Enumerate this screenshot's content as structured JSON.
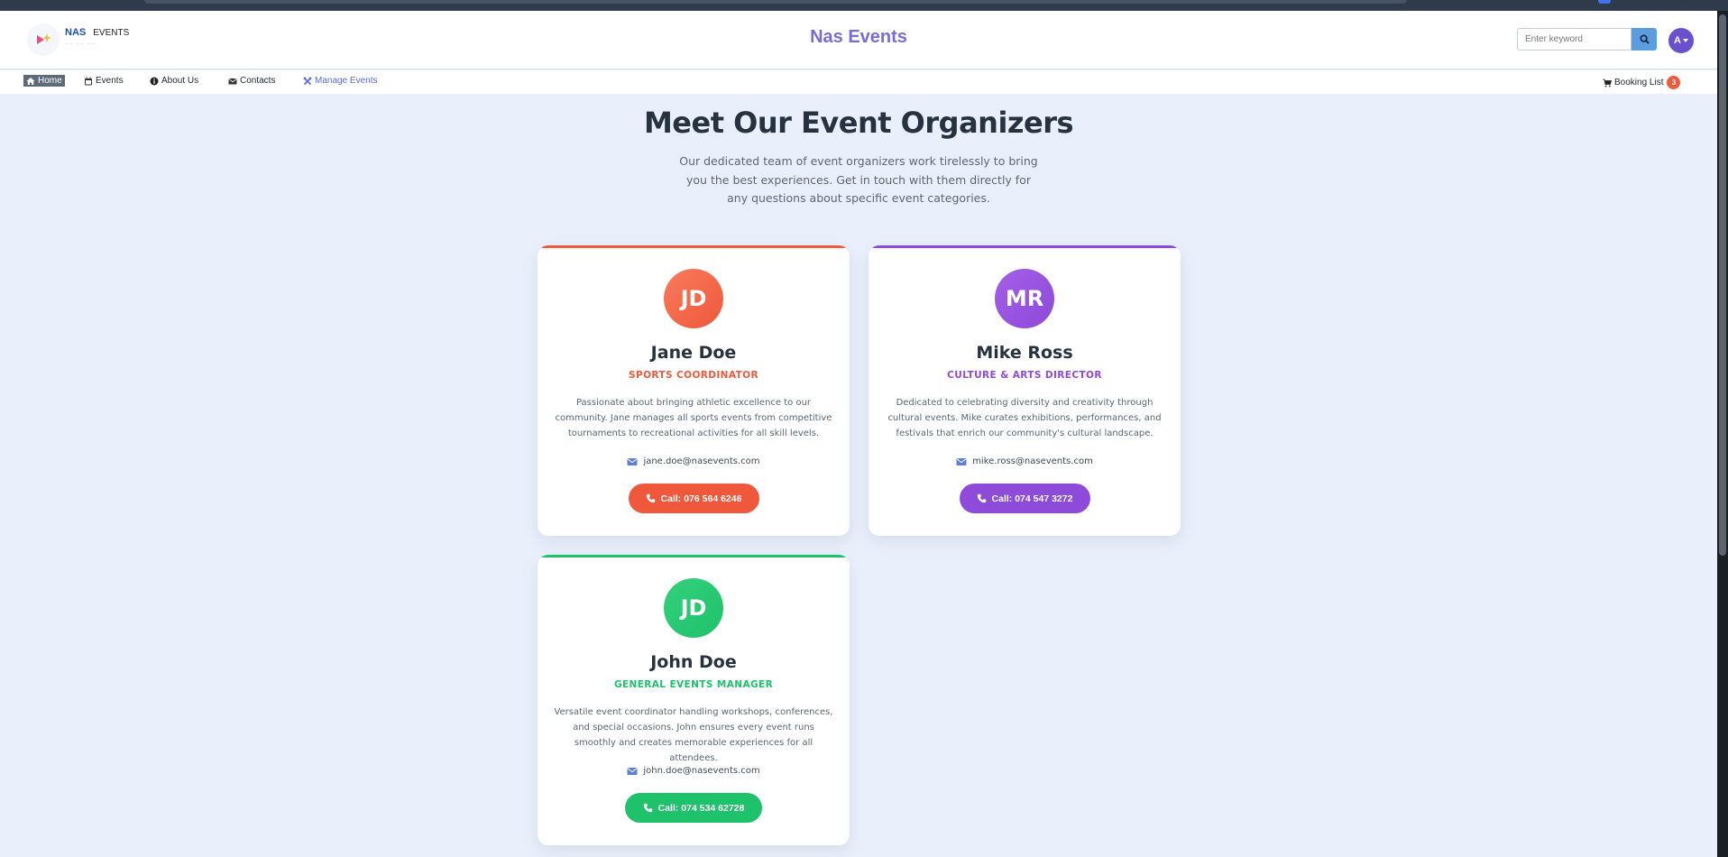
{
  "brand": {
    "logo_nas": "NAS",
    "logo_events": "EVENTS",
    "logo_tagline": "—— —— ——",
    "site_title": "Nas Events"
  },
  "search": {
    "placeholder": "Enter keyword",
    "icon": "search-icon"
  },
  "user": {
    "avatar_initial": "A"
  },
  "nav": {
    "home": "Home",
    "events": "Events",
    "about": "About Us",
    "contacts": "Contacts",
    "manage": "Manage Events",
    "booking": "Booking List",
    "booking_count": "3"
  },
  "hero": {
    "title": "Meet Our Event Organizers",
    "subtitle": "Our dedicated team of event organizers work tirelessly to bring you the best experiences. Get in touch with them directly for any questions about specific event categories."
  },
  "organizers": [
    {
      "initials": "JD",
      "name": "Jane Doe",
      "role": "SPORTS COORDINATOR",
      "description": "Passionate about bringing athletic excellence to our community. Jane manages all sports events from competitive tournaments to recreational activities for all skill levels.",
      "email": "jane.doe@nasevents.com",
      "call": "Call: 076 564 6246",
      "color": "#f0583b",
      "color_light": "#f97a5c"
    },
    {
      "initials": "MR",
      "name": "Mike Ross",
      "role": "CULTURE & ARTS DIRECTOR",
      "description": "Dedicated to celebrating diversity and creativity through cultural events. Mike curates exhibitions, performances, and festivals that enrich our community's cultural landscape.",
      "email": "mike.ross@nasevents.com",
      "call": "Call: 074 547 3272",
      "color": "#8e4ad9",
      "color_light": "#a25fe6"
    },
    {
      "initials": "JD",
      "name": "John Doe",
      "role": "GENERAL EVENTS MANAGER",
      "description": "Versatile event coordinator handling workshops, conferences, and special occasions. John ensures every event runs smoothly and creates memorable experiences for all attendees.",
      "email": "john.doe@nasevents.com",
      "call": "Call: 074 534 62728",
      "color": "#1ec26a",
      "color_light": "#34d07b"
    }
  ],
  "colors": {
    "accent": "#7a6cd6",
    "search_button": "#5b9ee0",
    "page_bg": "#eaf0fb"
  }
}
